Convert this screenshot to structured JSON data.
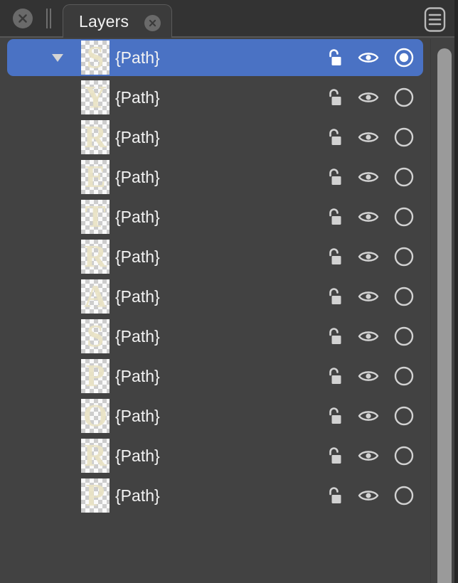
{
  "window": {
    "background_color": "#424242",
    "accent_color": "#4a72c4"
  },
  "tabbar": {
    "close_all_label": "×",
    "drag_handle_label": "",
    "tab": {
      "label": "Layers",
      "close_label": "×",
      "active": "true"
    },
    "menu_label": ""
  },
  "layers": {
    "selected_index": 0,
    "rows": [
      {
        "label": "{Path}",
        "thumb": "S",
        "selected": true,
        "expanded": true,
        "lock": "unlocked",
        "visible": "visible",
        "target": "on"
      },
      {
        "label": "{Path}",
        "thumb": "Y",
        "selected": false,
        "expanded": false,
        "lock": "unlocked",
        "visible": "visible",
        "target": "off"
      },
      {
        "label": "{Path}",
        "thumb": "R",
        "selected": false,
        "expanded": false,
        "lock": "unlocked",
        "visible": "visible",
        "target": "off"
      },
      {
        "label": "{Path}",
        "thumb": "E",
        "selected": false,
        "expanded": false,
        "lock": "unlocked",
        "visible": "visible",
        "target": "off"
      },
      {
        "label": "{Path}",
        "thumb": "T",
        "selected": false,
        "expanded": false,
        "lock": "unlocked",
        "visible": "visible",
        "target": "off"
      },
      {
        "label": "{Path}",
        "thumb": "R",
        "selected": false,
        "expanded": false,
        "lock": "unlocked",
        "visible": "visible",
        "target": "off"
      },
      {
        "label": "{Path}",
        "thumb": "A",
        "selected": false,
        "expanded": false,
        "lock": "unlocked",
        "visible": "visible",
        "target": "off"
      },
      {
        "label": "{Path}",
        "thumb": "S",
        "selected": false,
        "expanded": false,
        "lock": "unlocked",
        "visible": "visible",
        "target": "off"
      },
      {
        "label": "{Path}",
        "thumb": "P",
        "selected": false,
        "expanded": false,
        "lock": "unlocked",
        "visible": "visible",
        "target": "off"
      },
      {
        "label": "{Path}",
        "thumb": "O",
        "selected": false,
        "expanded": false,
        "lock": "unlocked",
        "visible": "visible",
        "target": "off"
      },
      {
        "label": "{Path}",
        "thumb": "R",
        "selected": false,
        "expanded": false,
        "lock": "unlocked",
        "visible": "visible",
        "target": "off"
      },
      {
        "label": "{Path}",
        "thumb": "P",
        "selected": false,
        "expanded": false,
        "lock": "unlocked",
        "visible": "visible",
        "target": "off"
      }
    ]
  },
  "scrollbar": {
    "orientation": "vertical",
    "thumb_position": "top"
  }
}
